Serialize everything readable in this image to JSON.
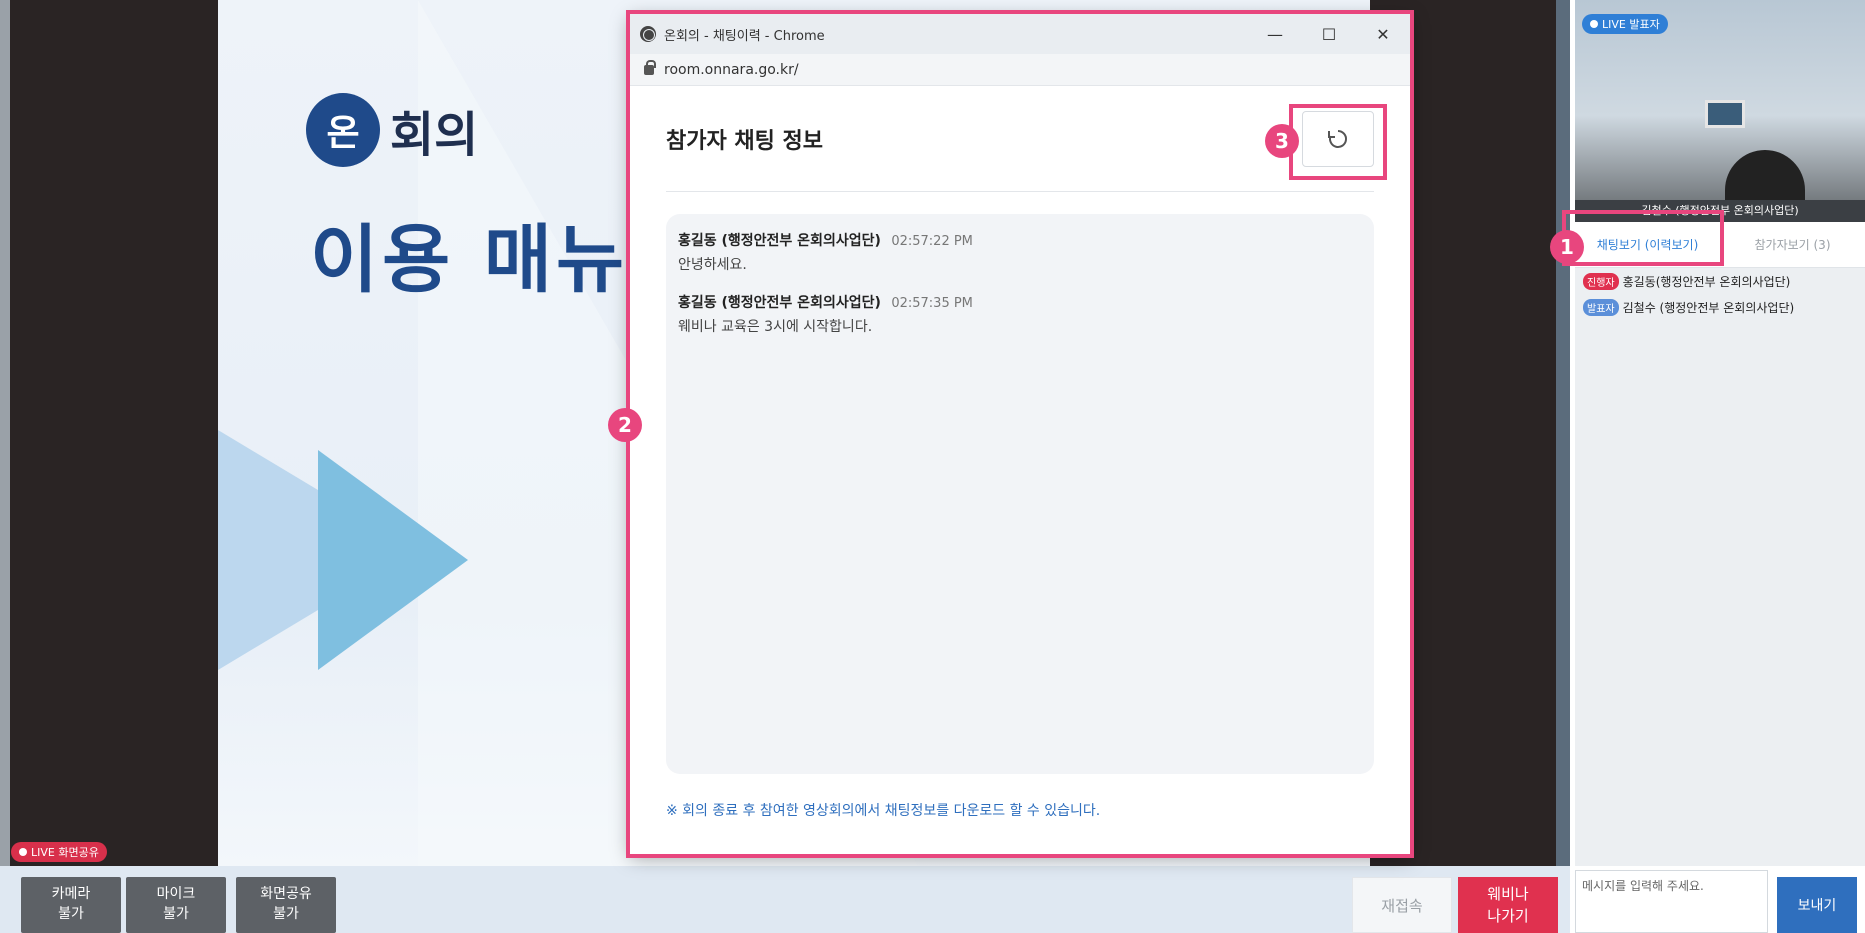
{
  "slide": {
    "logo_mark": "온",
    "logo_text": "회의",
    "title": "이용 매뉴"
  },
  "stage": {
    "live_share_label": "LIVE 화면공유"
  },
  "controls": {
    "camera": [
      "카메라",
      "불가"
    ],
    "mic": [
      "마이크",
      "불가"
    ],
    "screen_share": [
      "화면공유",
      "불가"
    ],
    "reconnect": "재접속",
    "leave": [
      "웨비나",
      "나가기"
    ]
  },
  "right_panel": {
    "live_presenter_label": "LIVE 발표자",
    "video_name": "김철수 (행정안전부 온회의사업단)",
    "tab_chat": "채팅보기 (이력보기)",
    "tab_participants": "참가자보기 (3)",
    "participants": [
      {
        "role": "진행자",
        "role_type": "host",
        "name": "홍길동(행정안전부 온회의사업단)"
      },
      {
        "role": "발표자",
        "role_type": "presenter",
        "name": "김철수 (행정안전부 온회의사업단)"
      }
    ],
    "message_placeholder": "메시지를 입력해 주세요.",
    "send": "보내기"
  },
  "popup": {
    "window_title": "온회의 - 채팅이력 - Chrome",
    "url": "room.onnara.go.kr/",
    "win_controls": [
      "—",
      "☐",
      "✕"
    ],
    "heading": "참가자 채팅 정보",
    "refresh_icon": "refresh-icon",
    "messages": [
      {
        "sender": "홍길동 (행정안전부 온회의사업단)",
        "time": "02:57:22 PM",
        "text": "안녕하세요."
      },
      {
        "sender": "홍길동 (행정안전부 온회의사업단)",
        "time": "02:57:35 PM",
        "text": "웨비나 교육은 3시에 시작합니다."
      }
    ],
    "notice": "※ 회의 종료 후 참여한 영상회의에서 채팅정보를 다운로드 할 수 있습니다."
  },
  "callouts": [
    "1",
    "2",
    "3"
  ],
  "colors": {
    "callout": "#e8467e",
    "brand_blue": "#1f4a8a",
    "leave_red": "#e0314f",
    "send_blue": "#2f6fbe"
  }
}
